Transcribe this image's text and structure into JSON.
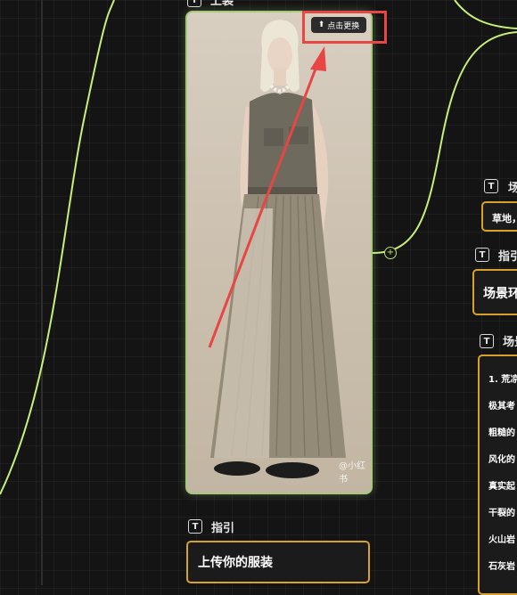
{
  "image_node": {
    "title": "上装",
    "replace_button_label": "点击更换",
    "watermark": "@小红书"
  },
  "guide_node": {
    "title": "指引",
    "content": "上传你的服装"
  },
  "right_nodes": {
    "scene_title": "场景",
    "scene_value": "草地，",
    "guide_title": "指引",
    "guide_content": "场景环",
    "desc_title": "场景",
    "desc_lines": [
      "1. 荒凉",
      "极其考",
      "粗糙的",
      "风化的",
      "真实起",
      "干裂的",
      "火山岩",
      "石灰岩"
    ]
  },
  "colors": {
    "wire": "#c6f07a",
    "node_border_gold": "#d7a227",
    "image_border": "#a7c77a",
    "annotation_red": "#e84545"
  }
}
